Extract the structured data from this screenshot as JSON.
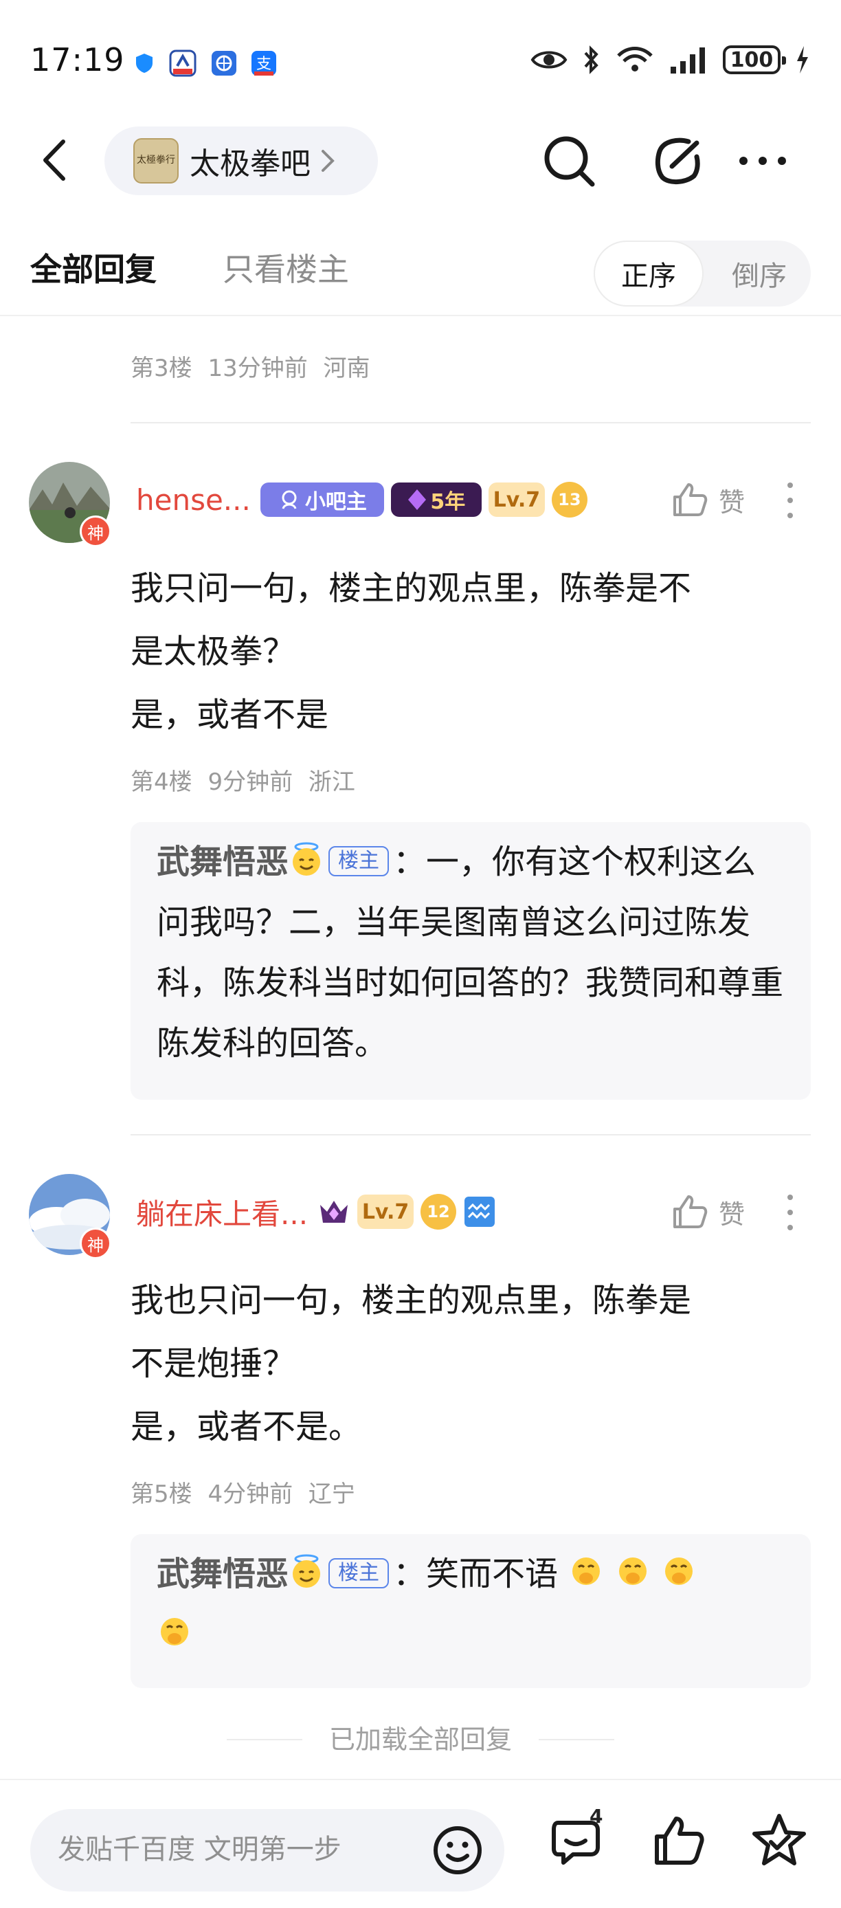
{
  "status_bar": {
    "time": "17:19",
    "battery": "100"
  },
  "nav": {
    "forum_name": "太极拳吧",
    "forum_logo_text": "太極拳行"
  },
  "filter": {
    "tab_all": "全部回复",
    "tab_op_only": "只看楼主",
    "sort_asc": "正序",
    "sort_desc": "倒序"
  },
  "posts": [
    {
      "floor": "第3楼",
      "time": "13分钟前",
      "location": "河南"
    },
    {
      "username": "hense...",
      "badge_admin": "小吧主",
      "badge_years": "5年",
      "badge_level": "Lv.7",
      "badge_num": "13",
      "like_label": "赞",
      "god_label": "神",
      "body_lines": [
        "我只问一句，楼主的观点里，陈拳是不",
        "是太极拳？",
        "是，或者不是"
      ],
      "floor": "第4楼",
      "time": "9分钟前",
      "location": "浙江",
      "reply": {
        "user": "武舞悟恶",
        "tag": "楼主",
        "colon": "：",
        "text": "一，你有这个权利这么问我吗？二，当年吴图南曾这么问过陈发科，陈发科当时如何回答的？我赞同和尊重陈发科的回答。"
      }
    },
    {
      "username": "躺在床上看...",
      "badge_level": "Lv.7",
      "badge_num": "12",
      "like_label": "赞",
      "god_label": "神",
      "body_lines": [
        "我也只问一句，楼主的观点里，陈拳是",
        "不是炮捶？",
        "是，或者不是。"
      ],
      "floor": "第5楼",
      "time": "4分钟前",
      "location": "辽宁",
      "reply": {
        "user": "武舞悟恶",
        "tag": "楼主",
        "colon": "：",
        "text": "笑而不语"
      }
    }
  ],
  "loaded_all": "已加载全部回复",
  "bottom": {
    "compose_placeholder": "发贴千百度 文明第一步",
    "comment_count": "4"
  },
  "colors": {
    "username_red": "#e2483d",
    "op_tag_blue": "#4a73d8",
    "meta_gray": "#9a9a9a"
  }
}
